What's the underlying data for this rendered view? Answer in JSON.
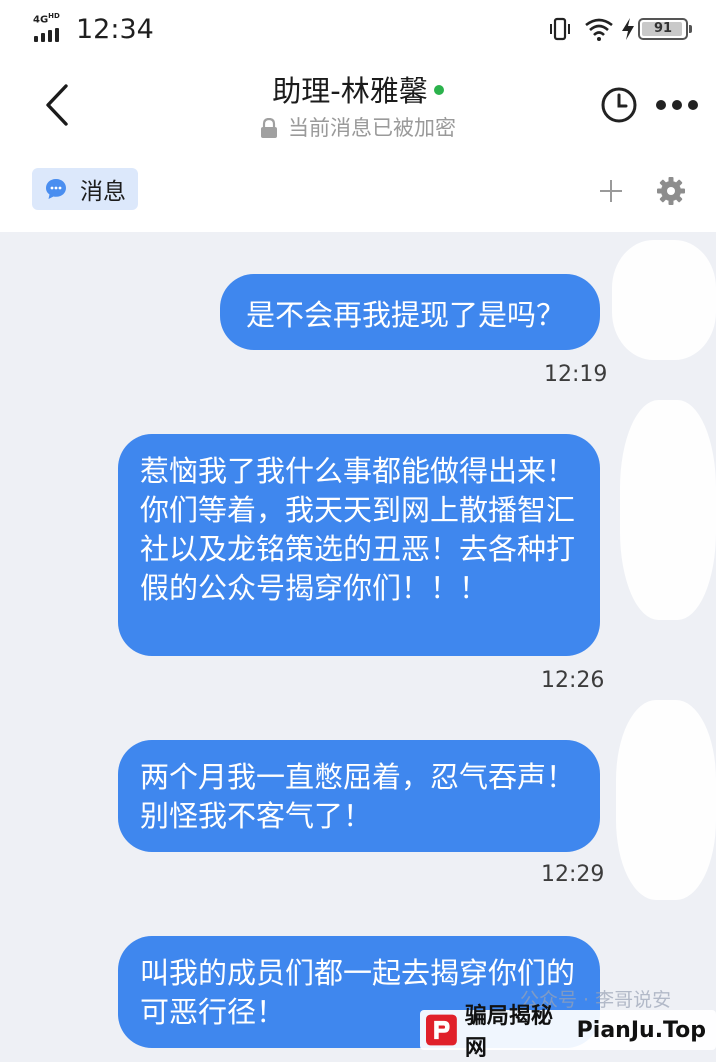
{
  "status_bar": {
    "network": "4G",
    "network_sup": "HD",
    "time": "12:34",
    "battery": "91"
  },
  "header": {
    "title": "助理-林雅馨",
    "subtitle": "当前消息已被加密",
    "online_color": "#2bb24c"
  },
  "tabs": {
    "messages_label": "消息"
  },
  "messages": [
    {
      "text": "是不会再我提现了是吗？",
      "time": "12:19"
    },
    {
      "text": "惹恼我了我什么事都能做得出来！你们等着，我天天到网上散播智汇社以及龙铭策选的丑恶！去各种打假的公众号揭穿你们！！！",
      "time": "12:26"
    },
    {
      "text": "两个月我一直憋屈着，忍气吞声！别怪我不客气了！",
      "time": "12:29"
    },
    {
      "text": "叫我的成员们都一起去揭穿你们的可恶行径！"
    }
  ],
  "watermark": {
    "name": "骗局揭秘网",
    "site": "PianJu.Top",
    "overlay_text": "公众号 · 李哥说安"
  },
  "colors": {
    "bubble": "#3f87ee",
    "background": "#eef0f5",
    "tab_highlight": "#dce8fb"
  }
}
